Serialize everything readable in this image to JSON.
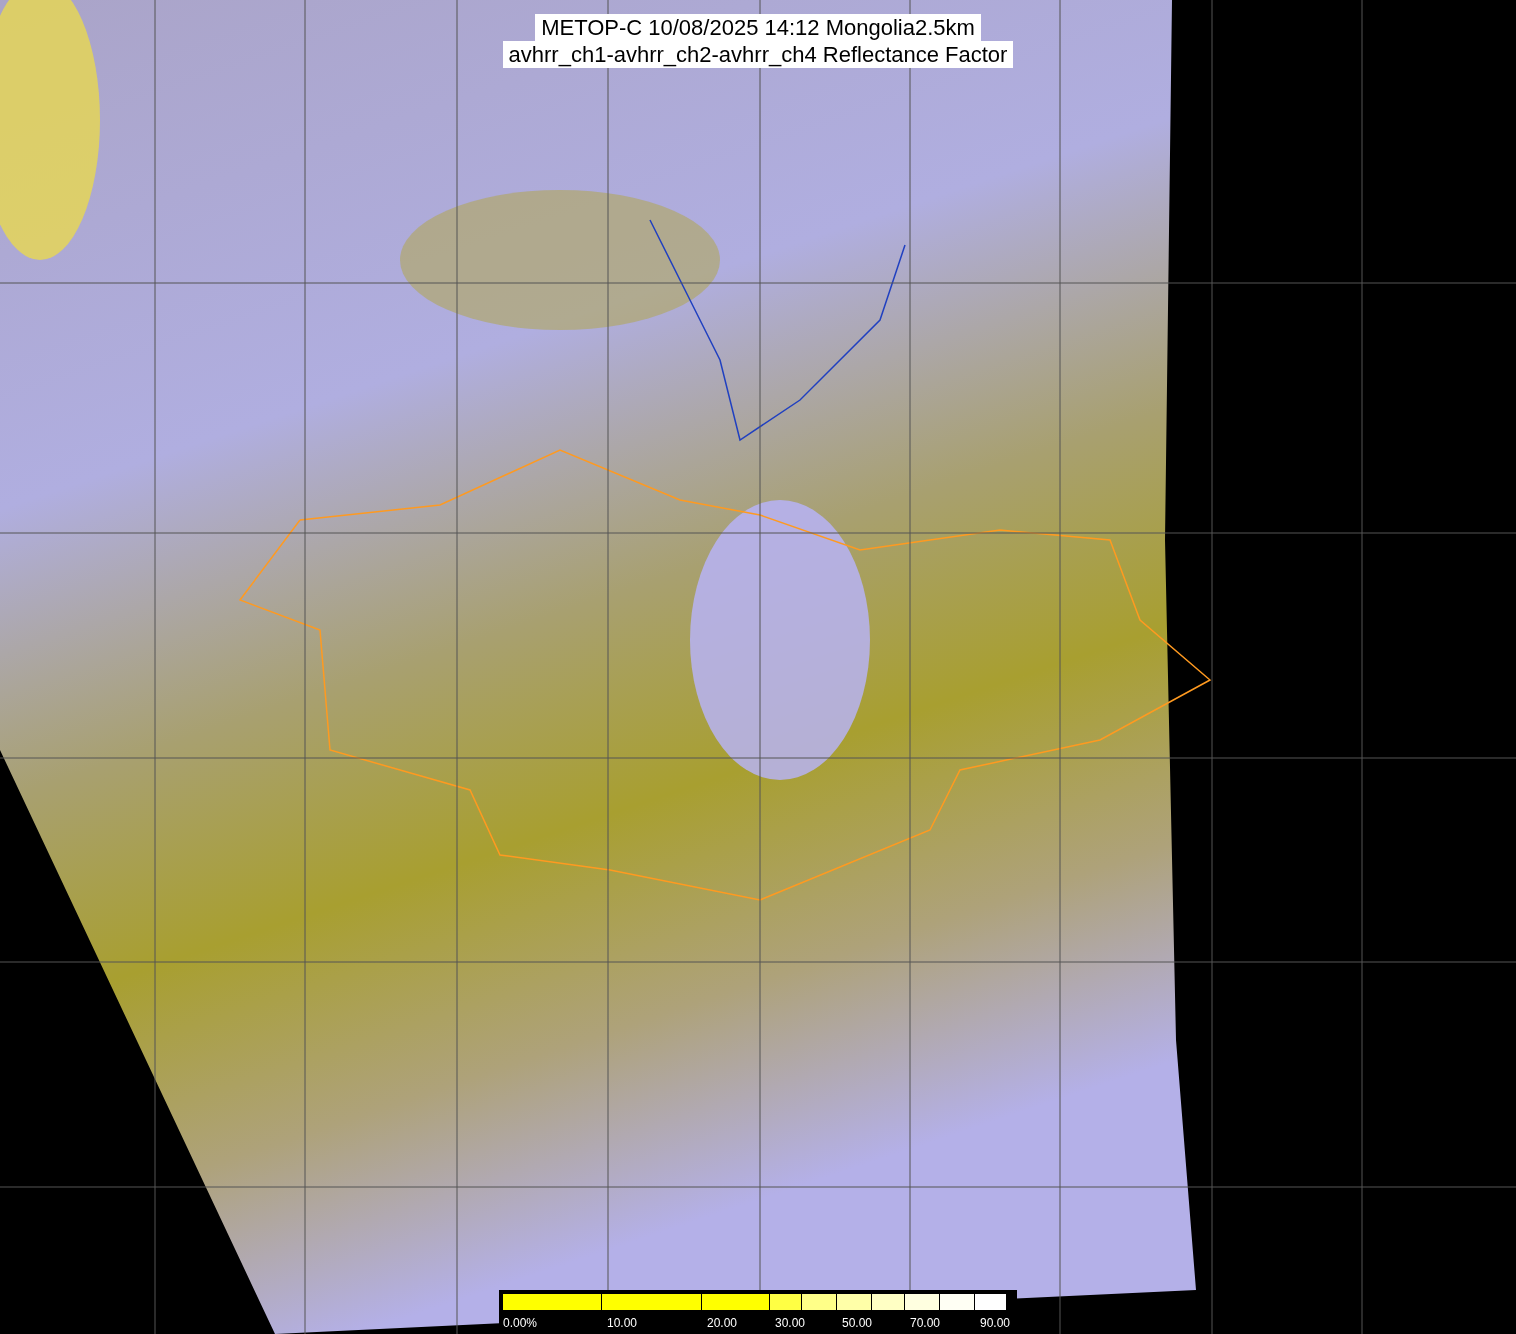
{
  "title_lines": [
    "METOP-C 10/08/2025 14:12 Mongolia2.5km",
    "avhrr_ch1-avhrr_ch2-avhrr_ch4 Reflectance Factor"
  ],
  "colorbar": {
    "segments": [
      {
        "color": "#ffff00"
      },
      {
        "color": "#ffff00"
      },
      {
        "color": "#ffff00"
      },
      {
        "color": "#ffff44"
      },
      {
        "color": "#ffff88"
      },
      {
        "color": "#ffffa8"
      },
      {
        "color": "#ffffc4"
      },
      {
        "color": "#ffffe0"
      },
      {
        "color": "#fffff4"
      },
      {
        "color": "#ffffff"
      }
    ],
    "labels": [
      "0.00%",
      "10.00",
      "20.00",
      "30.00",
      "50.00",
      "70.00",
      "90.00"
    ]
  }
}
